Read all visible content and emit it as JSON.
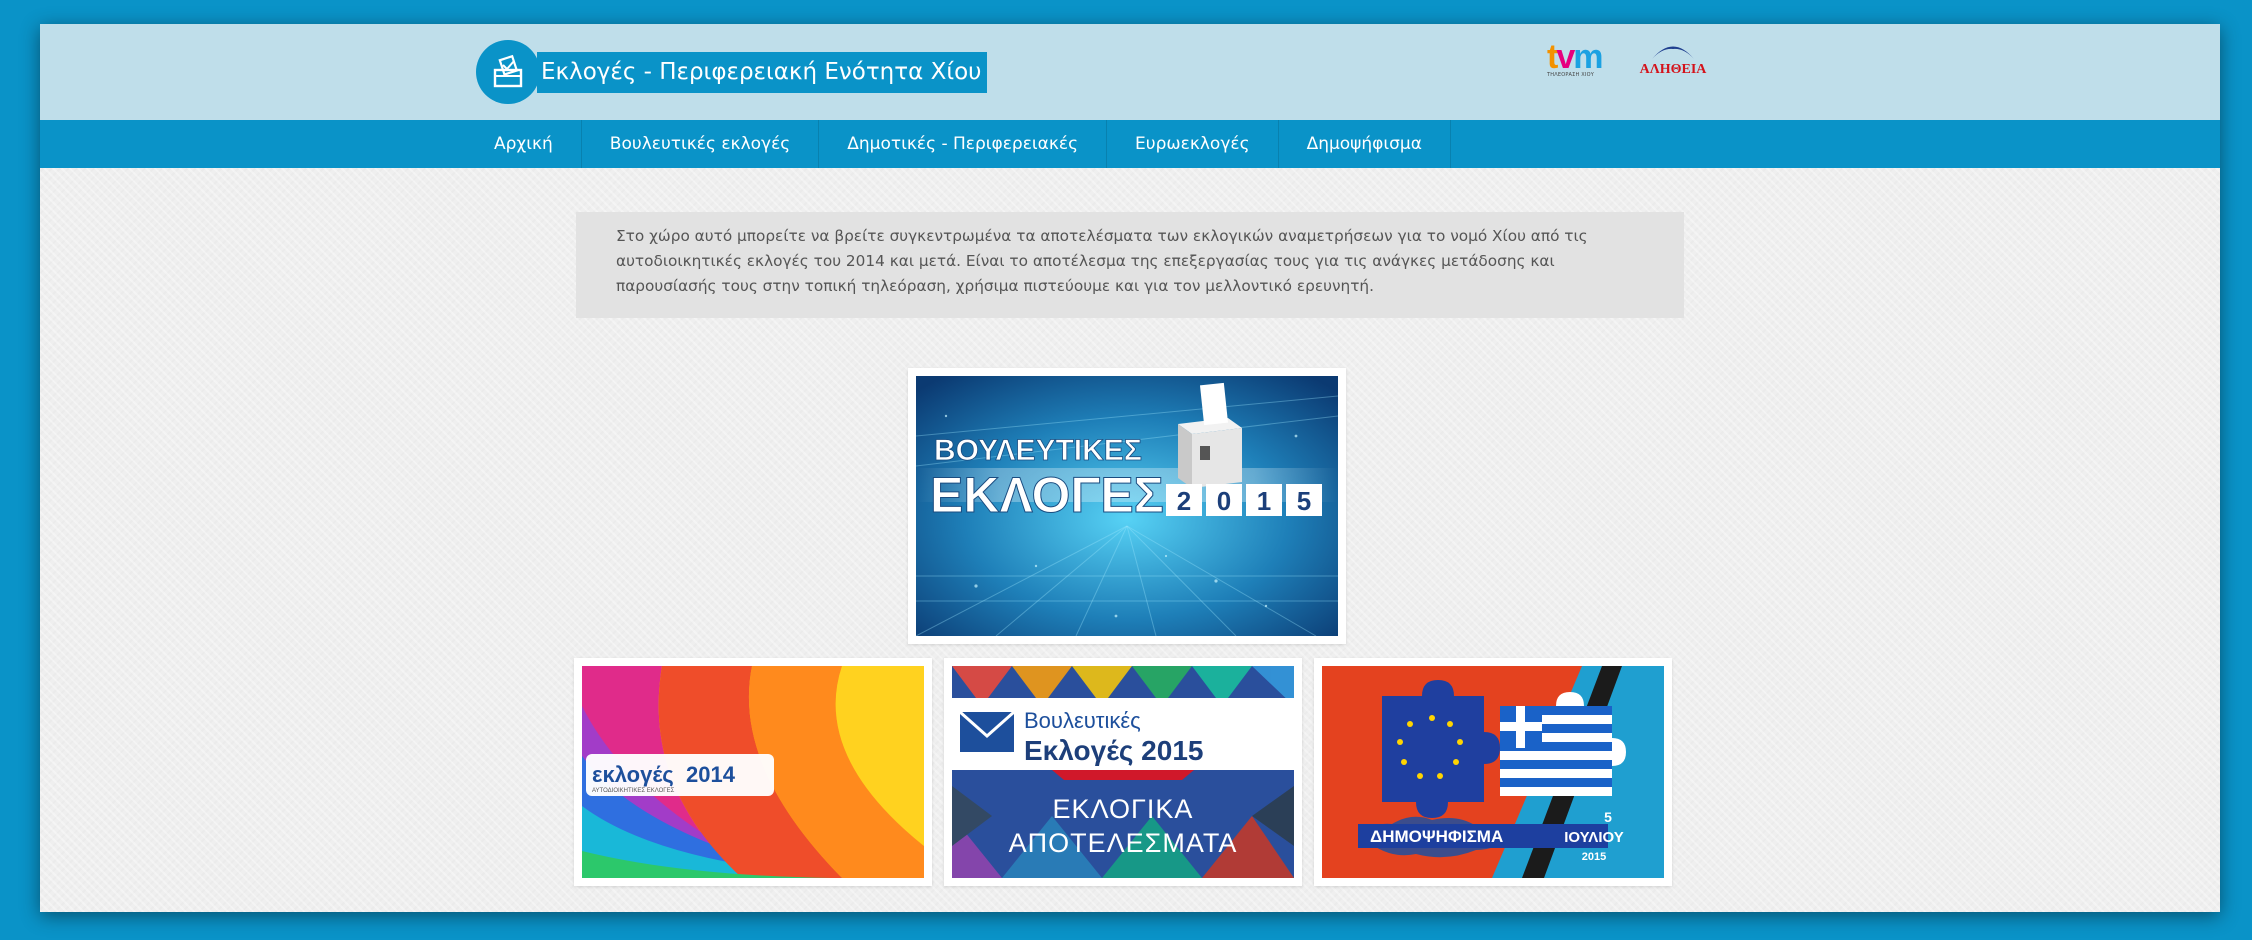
{
  "header": {
    "title": "Εκλογές - Περιφερειακή Ενότητα Χίου",
    "logo_icon": "ballot-box-icon",
    "partners": {
      "tvm": {
        "mark_t": "t",
        "mark_v": "v",
        "mark_m": "m",
        "subtitle": "ΤΗΛΕΟΡΑΣΗ ΧΙΟΥ"
      },
      "aletheia": {
        "name": "ΑΛΗΘΕΙΑ"
      }
    }
  },
  "nav": {
    "items": [
      {
        "label": "Αρχική"
      },
      {
        "label": "Βουλευτικές εκλογές"
      },
      {
        "label": "Δημοτικές - Περιφερειακές"
      },
      {
        "label": "Ευρωεκλογές"
      },
      {
        "label": "Δημοψήφισμα"
      }
    ]
  },
  "intro": {
    "text": "Στο χώρο αυτό μπορείτε να βρείτε συγκεντρωμένα τα αποτελέσματα των εκλογικών αναμετρήσεων για το νομό Χίου από τις αυτοδιοικητικές εκλογές του 2014 και μετά. Είναι το αποτέλεσμα της επεξεργασίας τους για τις ανάγκες μετάδοσης και παρουσίασής τους στην τοπική τηλεόραση, χρήσιμα πιστεύουμε και για τον μελλοντικό ερευνητή."
  },
  "cards": {
    "main": {
      "line1": "ΒΟΥΛΕΥΤΙΚΕΣ",
      "line2": "ΕΚΛΟΓΕΣ",
      "digits": [
        "2",
        "0",
        "1",
        "5"
      ]
    },
    "local2014": {
      "brand_word": "εκλογές",
      "brand_year": "2014",
      "brand_sub": "ΑΥΤΟΔΙΟΙΚΗΤΙΚΕΣ ΕΚΛΟΓΕΣ"
    },
    "results2015": {
      "line1": "Βουλευτικές",
      "line2": "Εκλογές 2015",
      "line3": "ΕΚΛΟΓΙΚΑ",
      "line4": "ΑΠΟΤΕΛΕΣΜΑΤΑ"
    },
    "referendum": {
      "label": "ΔΗΜΟΨΗΦΙΣΜΑ",
      "day": "5",
      "month": "ΙΟΥΛΙΟΥ",
      "year": "2015"
    }
  },
  "colors": {
    "brand_blue": "#0a93c8",
    "header_bg": "#bfdeea",
    "page_bg": "#efefef",
    "intro_bg": "#e2e2e2"
  }
}
